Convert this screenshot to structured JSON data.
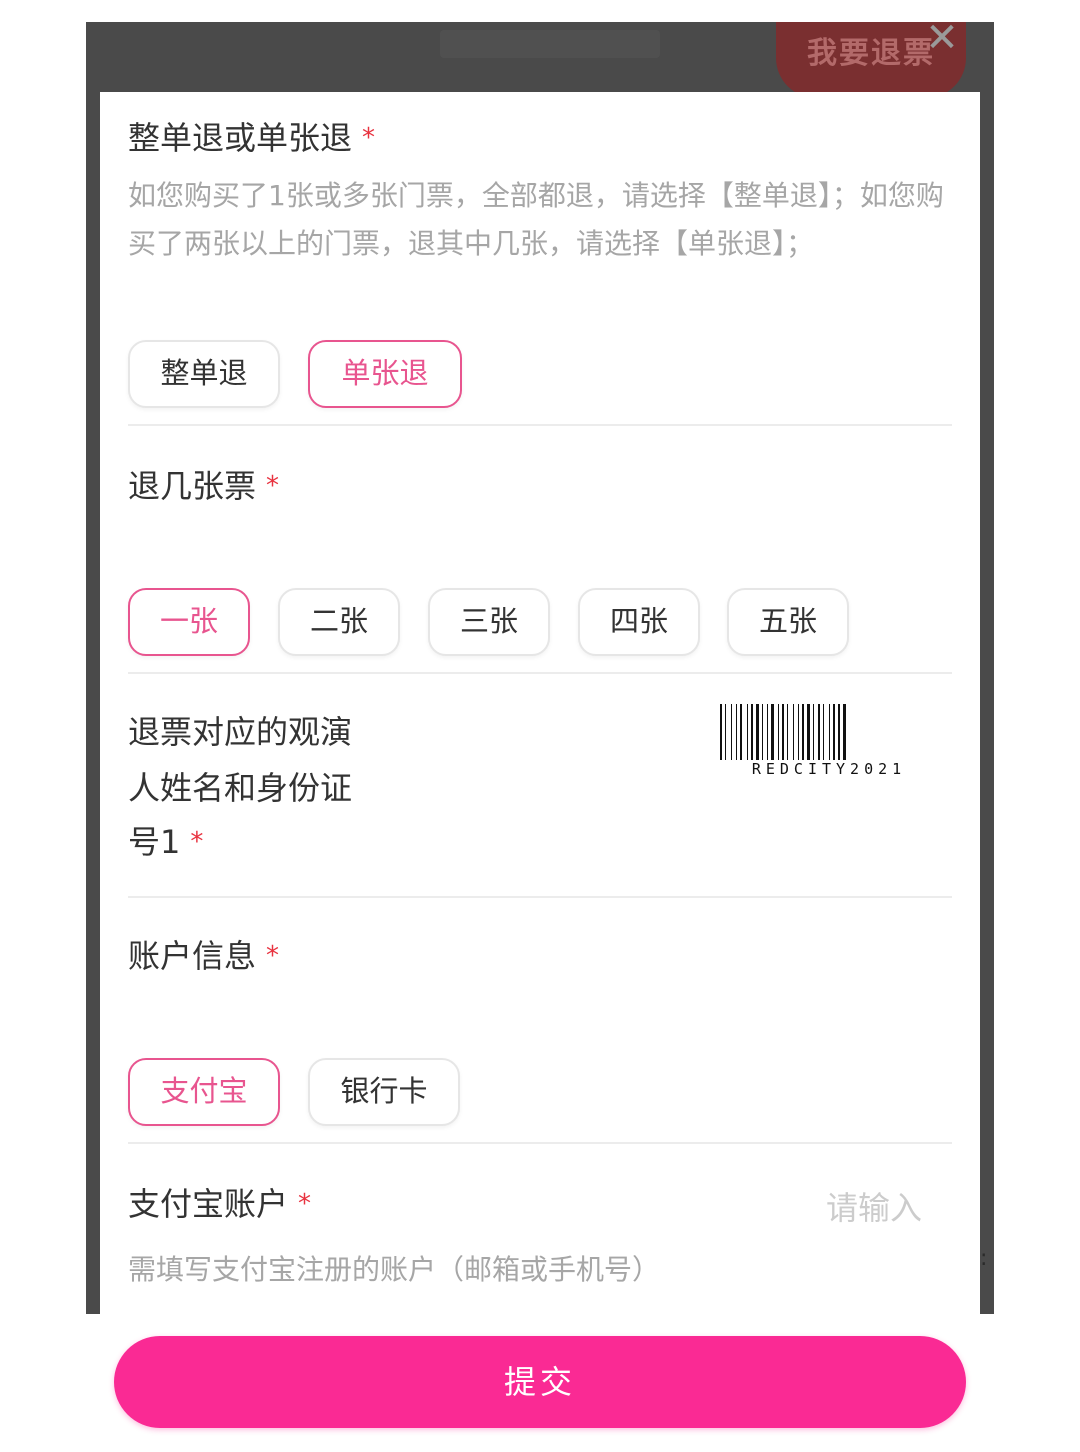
{
  "backdrop": {
    "header_button": "我要退票",
    "close_icon": "close-icon"
  },
  "refund_type": {
    "label": "整单退或单张退",
    "required_mark": "*",
    "description": "如您购买了1张或多张门票，全部都退，请选择【整单退】；如您购买了两张以上的门票，退其中几张，请选择【单张退】；",
    "options": [
      "整单退",
      "单张退"
    ],
    "selected": "单张退"
  },
  "ticket_count": {
    "label": "退几张票",
    "required_mark": "*",
    "options": [
      "一张",
      "二张",
      "三张",
      "四张",
      "五张"
    ],
    "selected": "一张"
  },
  "attendee": {
    "label_line1": "退票对应的观演",
    "label_line2": "人姓名和身份证",
    "label_line3": "号1",
    "required_mark": "*",
    "barcode_text": "REDCITY2021"
  },
  "account_info": {
    "label": "账户信息",
    "required_mark": "*",
    "options": [
      "支付宝",
      "银行卡"
    ],
    "selected": "支付宝"
  },
  "alipay_account": {
    "label": "支付宝账户",
    "required_mark": "*",
    "placeholder": "请输入",
    "hint": "需填写支付宝注册的账户（邮箱或手机号）"
  },
  "submit": {
    "label": "提交"
  },
  "colors": {
    "accent": "#fa2a94",
    "selected_border": "#e8558f",
    "required": "#e8323f"
  }
}
